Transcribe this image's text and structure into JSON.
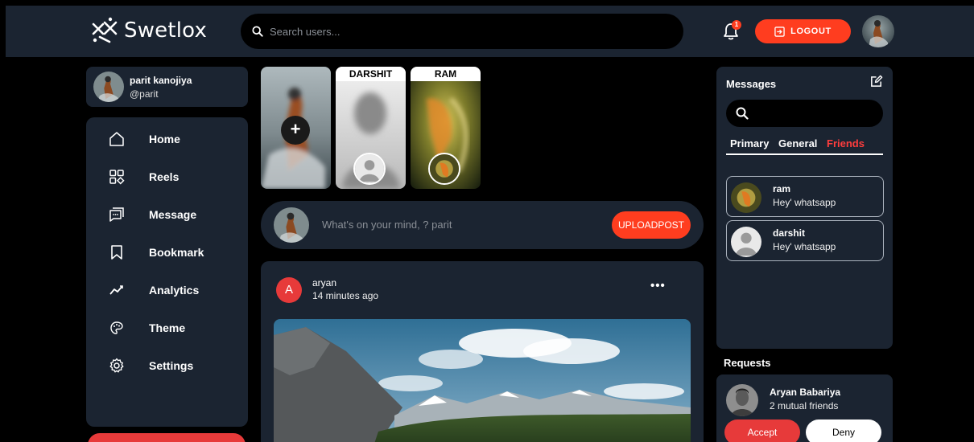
{
  "brand": {
    "name": "Swetlox",
    "logo_icon": "swetlox-logo-icon"
  },
  "header": {
    "search_placeholder": "Search users...",
    "notification_count": "1",
    "logout_label": "LOGOUT"
  },
  "profile": {
    "name": "parit kanojiya",
    "handle": "@parit"
  },
  "sidebar": {
    "items": [
      {
        "label": "Home",
        "icon": "home-icon"
      },
      {
        "label": "Reels",
        "icon": "reels-icon"
      },
      {
        "label": "Message",
        "icon": "message-icon"
      },
      {
        "label": "Bookmark",
        "icon": "bookmark-icon"
      },
      {
        "label": "Analytics",
        "icon": "analytics-icon"
      },
      {
        "label": "Theme",
        "icon": "theme-icon"
      },
      {
        "label": "Settings",
        "icon": "settings-icon"
      }
    ]
  },
  "stories": [
    {
      "name": "",
      "add_label": "+"
    },
    {
      "name": "DARSHIT"
    },
    {
      "name": "RAM"
    }
  ],
  "composer": {
    "placeholder": "What's on your mind, ? parit",
    "upload_label": "UPLOADPOST"
  },
  "post": {
    "avatar_letter": "A",
    "user": "aryan",
    "time": "14 minutes ago",
    "menu": "•••"
  },
  "messages": {
    "title": "Messages",
    "tabs": [
      "Primary",
      "General",
      "Friends"
    ],
    "active_tab": "Friends",
    "items": [
      {
        "name": "ram",
        "text": "Hey' whatsapp"
      },
      {
        "name": "darshit",
        "text": "Hey' whatsapp"
      }
    ]
  },
  "requests": {
    "title": "Requests",
    "items": [
      {
        "name": "Aryan Babariya",
        "mutual": "2 mutual friends",
        "accept_label": "Accept",
        "deny_label": "Deny"
      }
    ]
  },
  "colors": {
    "accent": "#ff3d1f",
    "panel": "#1b2431",
    "background": "#000000",
    "danger_button": "#e73a3a"
  }
}
